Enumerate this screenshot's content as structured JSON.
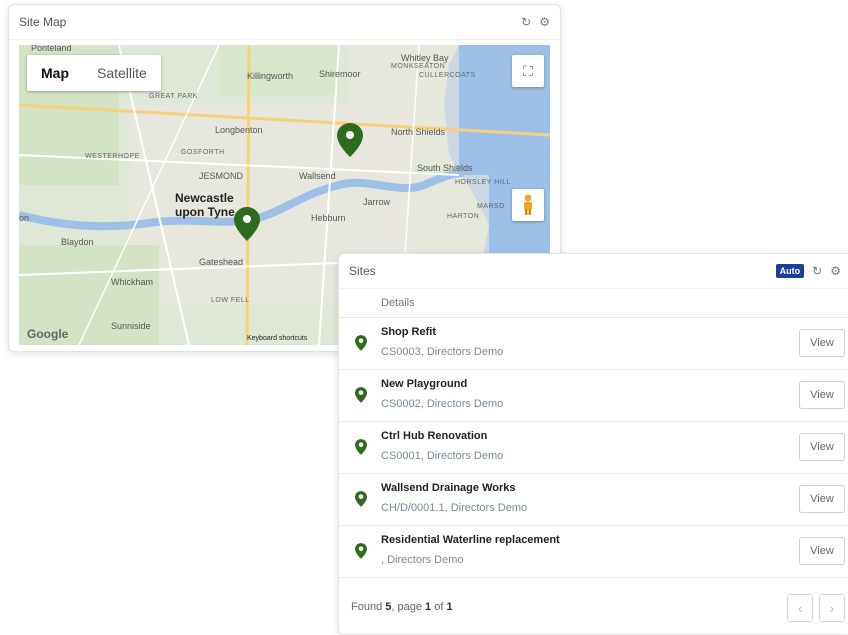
{
  "map_card": {
    "title": "Site Map",
    "refresh_icon": "refresh-icon",
    "settings_icon": "gear-icon",
    "toggle": {
      "map": "Map",
      "satellite": "Satellite",
      "active": "Map"
    },
    "fullscreen_icon": "fullscreen-icon",
    "pegman_icon": "pegman-icon",
    "labels": {
      "whitley_bay": "Whitley Bay",
      "monkseaton": "MONKSEATON",
      "cullercoats": "CULLERCOATS",
      "killingworth": "Killingworth",
      "shiremoor": "Shiremoor",
      "great_park": "GREAT PARK",
      "longbenton": "Longbenton",
      "north_shields": "North Shields",
      "westerhope": "WESTERHOPE",
      "gosforth": "GOSFORTH",
      "jesmond": "JESMOND",
      "wallsend": "Wallsend",
      "south_shields": "South Shields",
      "horsley_hill": "HORSLEY HILL",
      "newcastle1": "Newcastle",
      "newcastle2": "upon Tyne",
      "jarrow": "Jarrow",
      "hebburn": "Hebburn",
      "marsden": "MARSD",
      "harton": "HARTON",
      "blaydon": "Blaydon",
      "gateshead": "Gateshead",
      "whickham": "Whickham",
      "low_fell": "LOW FELL",
      "sunniside": "Sunniside",
      "ponteland": "Ponteland",
      "tn": "on"
    },
    "attribution": "Keyboard shortcuts",
    "google": "Google"
  },
  "sites_card": {
    "title": "Sites",
    "badge": "Auto",
    "refresh_icon": "refresh-icon",
    "settings_icon": "gear-icon",
    "column_header": "Details",
    "view_label": "View",
    "rows": [
      {
        "title": "Shop Refit",
        "sub": "CS0003, Directors Demo"
      },
      {
        "title": "New Playground",
        "sub": "CS0002, Directors Demo"
      },
      {
        "title": "Ctrl Hub Renovation",
        "sub": "CS0001, Directors Demo"
      },
      {
        "title": "Wallsend Drainage Works",
        "sub": "CH/D/0001.1, Directors Demo"
      },
      {
        "title": "Residential Waterline replacement",
        "sub": ", Directors Demo"
      }
    ],
    "footer": {
      "found_label": "Found",
      "count": "5",
      "page_label": ", page",
      "page": "1",
      "of_label": "of",
      "total_pages": "1"
    },
    "prev_icon": "chevron-left-icon",
    "next_icon": "chevron-right-icon"
  },
  "colors": {
    "pin": "#2e6b1f",
    "badge": "#1c3d9c",
    "water": "#9cc0e8",
    "land": "#dfe8d6"
  }
}
